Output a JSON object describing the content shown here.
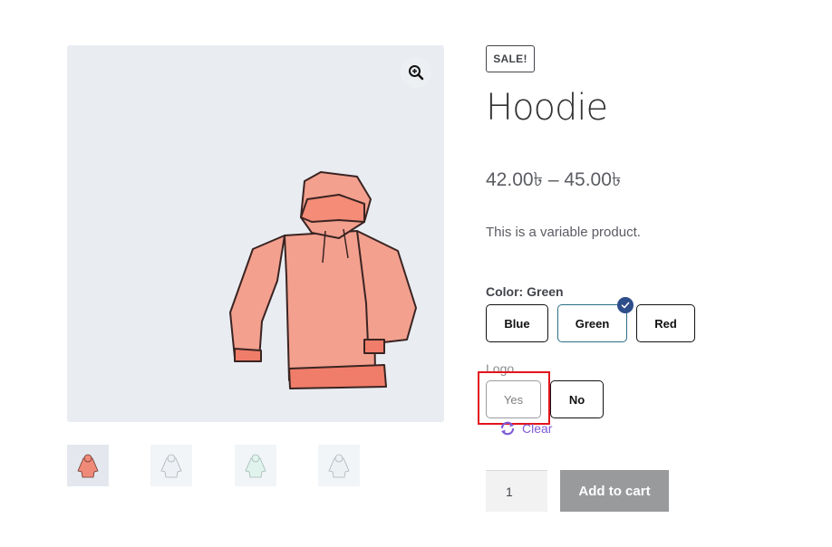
{
  "product": {
    "sale_badge": "SALE!",
    "title": "Hoodie",
    "price": "42.00৳ – 45.00৳",
    "description": "This is a variable product."
  },
  "gallery": {
    "zoom_icon": "zoom-in-icon",
    "thumbnail_colors": [
      "#f08a78",
      "#dfe7ee",
      "#c7ece0",
      "#dde6ec"
    ]
  },
  "variations": {
    "color": {
      "label": "Color: Green",
      "options": [
        {
          "label": "Blue",
          "selected": false
        },
        {
          "label": "Green",
          "selected": true
        },
        {
          "label": "Red",
          "selected": false
        }
      ]
    },
    "logo": {
      "label": "Logo",
      "options": [
        {
          "label": "Yes",
          "disabled": true,
          "highlighted": true
        },
        {
          "label": "No",
          "disabled": false
        }
      ]
    },
    "clear_label": "Clear"
  },
  "cart": {
    "quantity": "1",
    "add_to_cart_label": "Add to cart"
  },
  "colors": {
    "accent_purple": "#7e5bd6",
    "check_badge": "#2d4e8a",
    "highlight_red": "#e3141c",
    "button_gray": "#999a9c"
  }
}
